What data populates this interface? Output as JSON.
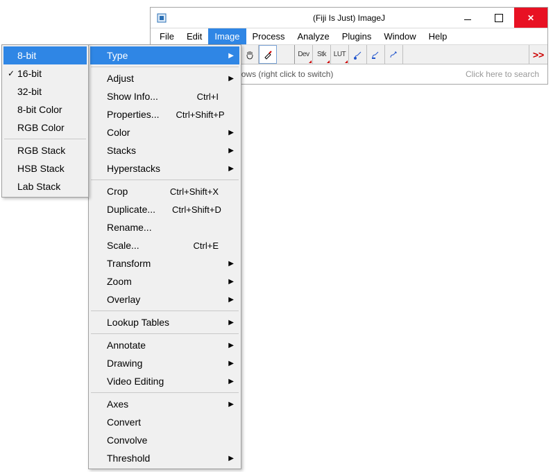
{
  "window": {
    "title": "(Fiji Is Just) ImageJ"
  },
  "menubar": [
    "File",
    "Edit",
    "Image",
    "Process",
    "Analyze",
    "Plugins",
    "Window",
    "Help"
  ],
  "menubar_active_index": 2,
  "status": {
    "hint": "or freehand lines, or arrows (right click to switch)",
    "search_placeholder": "Click here to search"
  },
  "toolbar_text_buttons": {
    "dev": "Dev",
    "stk": "Stk",
    "lut": "LUT"
  },
  "image_menu": [
    {
      "label": "Type",
      "submenu": true,
      "highlight": true
    },
    "sep",
    {
      "label": "Adjust",
      "submenu": true
    },
    {
      "label": "Show Info...",
      "shortcut": "Ctrl+I"
    },
    {
      "label": "Properties...",
      "shortcut": "Ctrl+Shift+P"
    },
    {
      "label": "Color",
      "submenu": true
    },
    {
      "label": "Stacks",
      "submenu": true
    },
    {
      "label": "Hyperstacks",
      "submenu": true
    },
    "sep",
    {
      "label": "Crop",
      "shortcut": "Ctrl+Shift+X"
    },
    {
      "label": "Duplicate...",
      "shortcut": "Ctrl+Shift+D"
    },
    {
      "label": "Rename..."
    },
    {
      "label": "Scale...",
      "shortcut": "Ctrl+E"
    },
    {
      "label": "Transform",
      "submenu": true
    },
    {
      "label": "Zoom",
      "submenu": true
    },
    {
      "label": "Overlay",
      "submenu": true
    },
    "sep",
    {
      "label": "Lookup Tables",
      "submenu": true
    },
    "sep",
    {
      "label": "Annotate",
      "submenu": true
    },
    {
      "label": "Drawing",
      "submenu": true
    },
    {
      "label": "Video Editing",
      "submenu": true
    },
    "sep",
    {
      "label": "Axes",
      "submenu": true
    },
    {
      "label": "Convert"
    },
    {
      "label": "Convolve"
    },
    {
      "label": "Threshold",
      "submenu": true
    }
  ],
  "type_submenu": [
    {
      "label": "8-bit",
      "highlight": true
    },
    {
      "label": "16-bit",
      "checked": true
    },
    {
      "label": "32-bit"
    },
    {
      "label": "8-bit Color"
    },
    {
      "label": "RGB Color"
    },
    "sep",
    {
      "label": "RGB Stack"
    },
    {
      "label": "HSB Stack"
    },
    {
      "label": "Lab Stack"
    }
  ]
}
